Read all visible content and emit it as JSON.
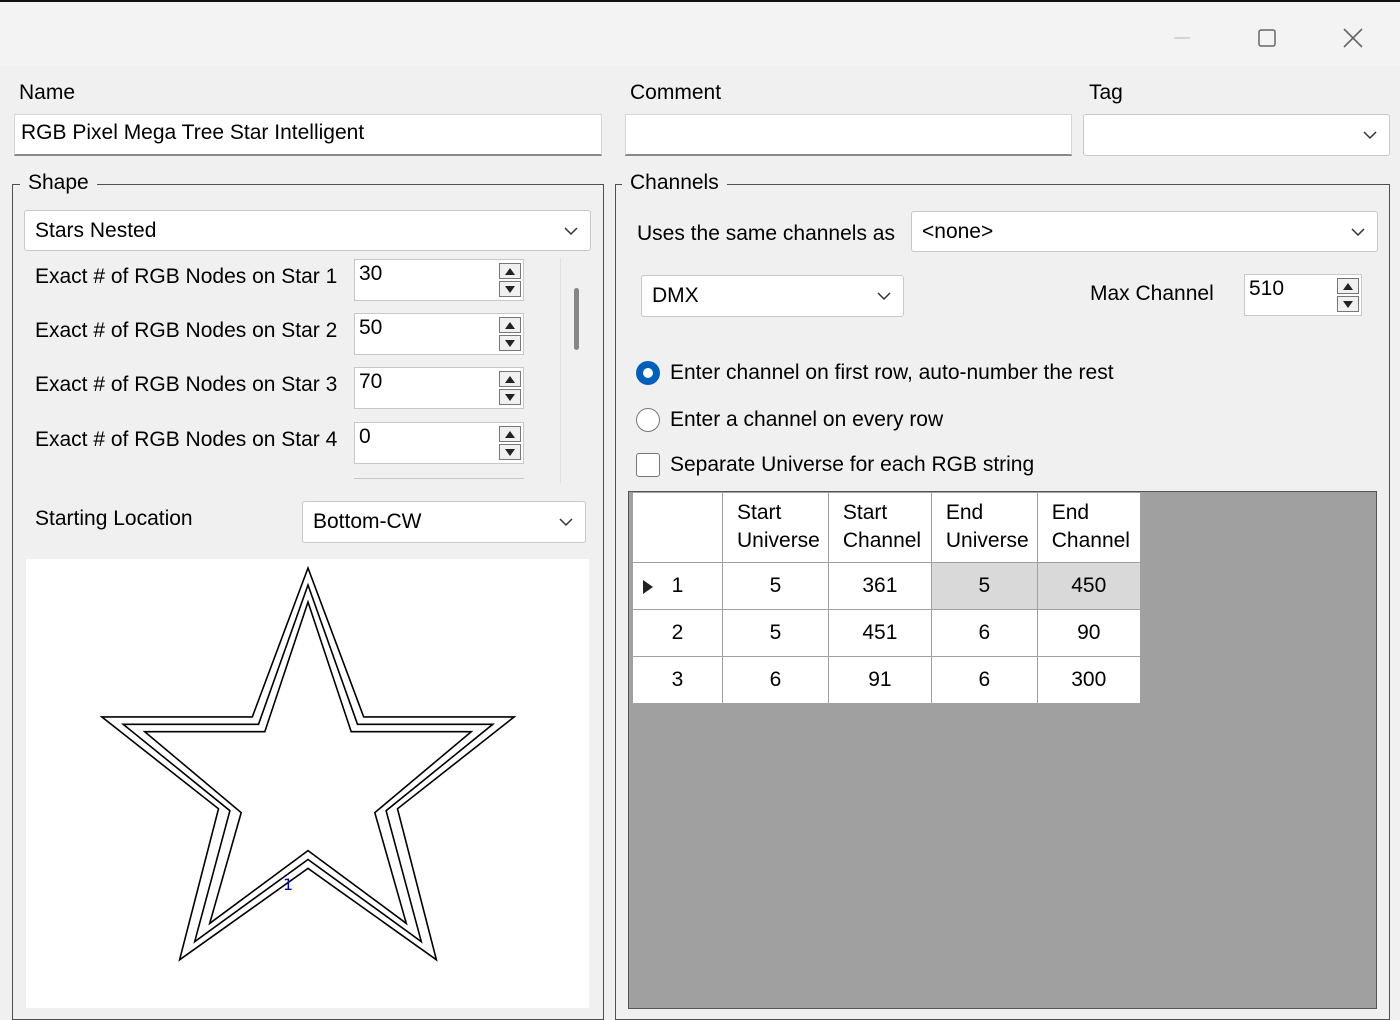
{
  "window": {
    "minimize_icon": "minimize-icon",
    "maximize_icon": "maximize-icon",
    "close_icon": "close-icon"
  },
  "name": {
    "label": "Name",
    "value": "RGB Pixel Mega Tree Star Intelligent"
  },
  "comment": {
    "label": "Comment",
    "value": ""
  },
  "tag": {
    "label": "Tag",
    "value": ""
  },
  "shape": {
    "group_title": "Shape",
    "shape_type": "Stars Nested",
    "node_rows": [
      {
        "label": "Exact # of RGB Nodes on Star 1",
        "value": "30"
      },
      {
        "label": "Exact # of RGB Nodes on Star 2",
        "value": "50"
      },
      {
        "label": "Exact # of RGB Nodes on Star 3",
        "value": "70"
      },
      {
        "label": "Exact # of RGB Nodes on Star 4",
        "value": "0"
      }
    ],
    "starting_location_label": "Starting Location",
    "starting_location_value": "Bottom-CW",
    "preview_start_marker": "1"
  },
  "channels": {
    "group_title": "Channels",
    "same_as_label": "Uses the same channels as",
    "same_as_value": "<none>",
    "protocol_value": "DMX",
    "max_channel_label": "Max Channel",
    "max_channel_value": "510",
    "radio_first_row": "Enter channel on first row, auto-number the rest",
    "radio_every_row": "Enter a channel on every row",
    "separate_universe": "Separate Universe for each RGB string",
    "grid": {
      "headers": [
        [
          "Start",
          "Universe"
        ],
        [
          "Start",
          "Channel"
        ],
        [
          "End",
          "Universe"
        ],
        [
          "End",
          "Channel"
        ]
      ],
      "rows": [
        {
          "num": "1",
          "cells": [
            "5",
            "361",
            "5",
            "450"
          ]
        },
        {
          "num": "2",
          "cells": [
            "5",
            "451",
            "6",
            "90"
          ]
        },
        {
          "num": "3",
          "cells": [
            "6",
            "91",
            "6",
            "300"
          ]
        }
      ]
    }
  },
  "colors": {
    "accent": "#005fb8",
    "grid_background": "#a0a0a0",
    "selected_cell": "#d9d9d9"
  }
}
